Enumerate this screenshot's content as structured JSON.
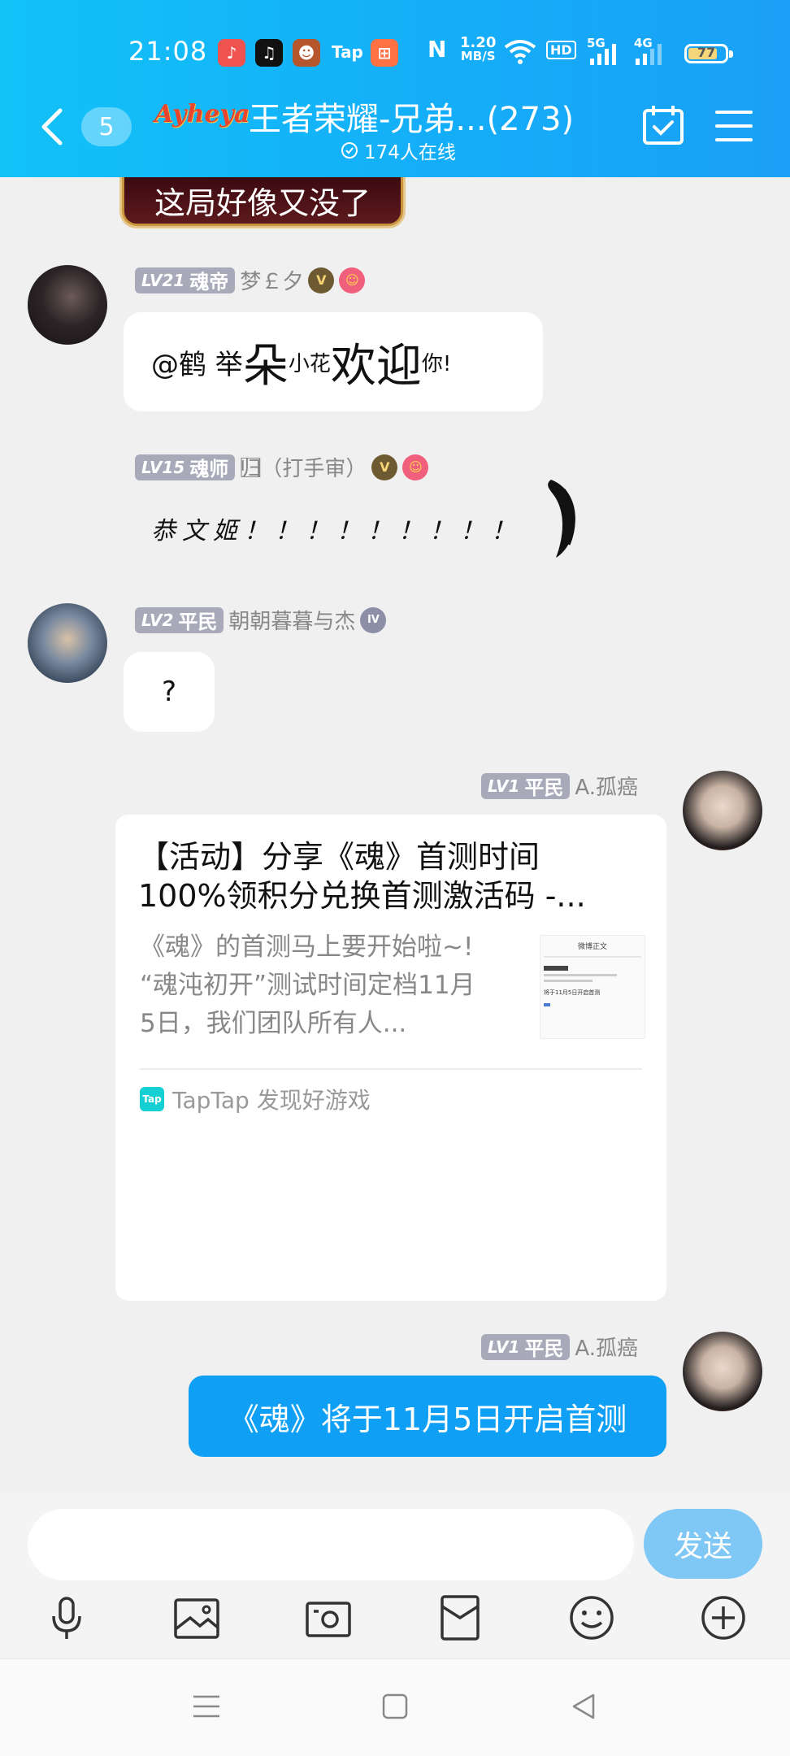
{
  "status_bar": {
    "time": "21:08",
    "tap_label": "Tap",
    "net_speed_value": "1.20",
    "net_speed_unit": "MB/S",
    "hd_label": "HD",
    "sig1_label": "5G",
    "sig2_label": "4G",
    "battery": "77",
    "battery_level": 0.77
  },
  "header": {
    "unread_count": "5",
    "logo_text": "Ayheya",
    "group_name": "王者荣耀-兄弟...(273)",
    "online_text": "174人在线"
  },
  "chat": {
    "prev_sticker_text": "这局好像又没了",
    "messages": [
      {
        "level_tag": "LV21",
        "rank": "魂帝",
        "nickname": "梦￡夕",
        "text_parts": [
          "@鹤 举",
          "朵",
          "小花",
          "欢迎",
          "你!"
        ]
      },
      {
        "level_tag": "LV15",
        "rank": "魂师",
        "nickname": "归⃞⃞⃞⃞（打手审）",
        "text": "恭文姬！！！！！！！！！"
      },
      {
        "level_tag": "LV2",
        "rank": "平民",
        "nickname": "朝朝暮暮与杰",
        "medal": "IV",
        "text": "?"
      },
      {
        "level_tag": "LV1",
        "rank": "平民",
        "nickname": "A.孤癌",
        "card": {
          "title_line1": "【活动】分享《魂》首测时间",
          "title_line2": "100%领积分兑换首测激活码 -...",
          "desc_line1": "《魂》的首测马上要开始啦~!",
          "desc_line2": "“魂沌初开”测试时间定档11月",
          "desc_line3": "5日，我们团队所有人...",
          "thumb_heading": "微博正文",
          "thumb_text": "将于11月5日开启首测",
          "source_logo": "Tap",
          "source": "TapTap 发现好游戏"
        }
      },
      {
        "level_tag": "LV1",
        "rank": "平民",
        "nickname": "A.孤癌",
        "text": "《魂》将于11月5日开启首测"
      }
    ]
  },
  "input": {
    "placeholder": "",
    "send_label": "发送"
  },
  "colors": {
    "header_start": "#12c2f7",
    "header_end": "#1aa0f6",
    "own_bubble": "#0fa0f5",
    "send_button": "#7fc8f5",
    "level_tag": "#a9aab9"
  },
  "icons": [
    "back-icon",
    "calendar-check-icon",
    "menu-icon",
    "clock-icon",
    "mic-icon",
    "image-icon",
    "camera-icon",
    "red-packet-icon",
    "emoji-icon",
    "plus-icon"
  ]
}
